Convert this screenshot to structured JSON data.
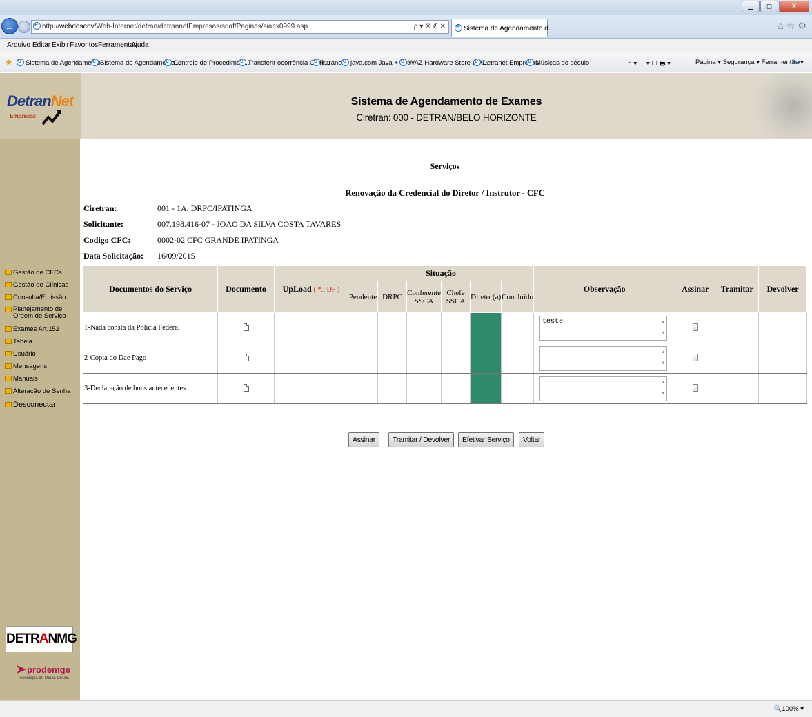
{
  "browser": {
    "url_prefix": "http://",
    "url_host": "webdesenv",
    "url_path": "/Web-Internet/detran/detrannetEmpresas/sdaf/Paginas/siaex0999.asp",
    "url_tools": "ρ ▾ ☒ ℭ ✕",
    "tab_title": "Sistema de Agendamento d...",
    "tab_close": "✕",
    "right_icons": "⌂☆⚙",
    "window_buttons": [
      "▁",
      "◻",
      "X"
    ],
    "menu": [
      "Arquivo",
      "Editar",
      "Exibir",
      "Favoritos",
      "Ferramentas",
      "Ajuda"
    ],
    "favorites": [
      "Sistema de Agendamento...",
      "Sistema de Agendamento...",
      "Controle de Procediment...",
      "Transferir ocorrência OCR...",
      "Intranet",
      "java.com Java + You",
      "WAZ Hardware Store WA...",
      "Detranet Empresas",
      "Músicas do século"
    ],
    "command_bar": "Página ▾   Segurança ▾   Ferramentas ▾",
    "command_icons": "⌂ ▾  ☷ ▾  ☐  🖶 ▾",
    "help": "? ▾",
    "zoom": "100%  ▾"
  },
  "header": {
    "logo_main": "Detran",
    "logo_accent": "Net",
    "logo_sub": "Empresas",
    "title": "Sistema de Agendamento de Exames",
    "subtitle": "Ciretran: 000 - DETRAN/BELO HORIZONTE"
  },
  "sidebar": {
    "items": [
      "Gestão de CFCs",
      "Gestão de Clínicas",
      "Consulta/Emissão",
      "Planejamento de Ordem de Serviço",
      "Exames Art.152",
      "Tabela",
      "Usuário",
      "Mensagens",
      "Manuais",
      "Alteração de Senha",
      "Desconectar"
    ],
    "detranmg_a": "DETR",
    "detranmg_b": "A",
    "detranmg_c": "NMG",
    "prodemge": "prodemge",
    "prodemge_sub": "Tecnologia de Minas Gerais"
  },
  "page": {
    "section_title": "Serviços",
    "service_title": "Renovação da Credencial do Diretor / Instrutor - CFC",
    "info": [
      {
        "label": "Ciretran:",
        "value": "001 - 1A. DRPC/IPATINGA"
      },
      {
        "label": "Solicitante:",
        "value": "007.198.416-07 - JOAO DA SILVA COSTA TAVARES"
      },
      {
        "label": "Codigo CFC:",
        "value": "0002-02 CFC GRANDE IPATINGA"
      },
      {
        "label": "Data Solicitação:",
        "value": "16/09/2015"
      }
    ]
  },
  "table": {
    "headers": {
      "documentos": "Documentos do Serviço",
      "documento": "Documento",
      "upload": "UpLoad",
      "upload_note": "( *.PDF )",
      "situacao": "Situação",
      "pendente": "Pendente",
      "drpc": "DRPC",
      "conferente": "Conferente SSCA",
      "chefe": "Chefe SSCA",
      "diretor": "Diretor(a)",
      "concluido": "Concluído",
      "observacao": "Observação",
      "assinar": "Assinar",
      "tramitar": "Tramitar",
      "devolver": "Devolver"
    },
    "rows": [
      {
        "name": "1-Nada consta da Policia Federal",
        "observacao": "teste"
      },
      {
        "name": "2-Copia do Dae Pago",
        "observacao": ""
      },
      {
        "name": "3-Declaração de bons antecedentes",
        "observacao": ""
      }
    ],
    "status_color": "#2e8a68"
  },
  "buttons": {
    "assinar": "Assinar",
    "tramitar_devolver": "Tramitar / Devolver",
    "efetivar": "Efetivar Serviço",
    "voltar": "Voltar"
  }
}
